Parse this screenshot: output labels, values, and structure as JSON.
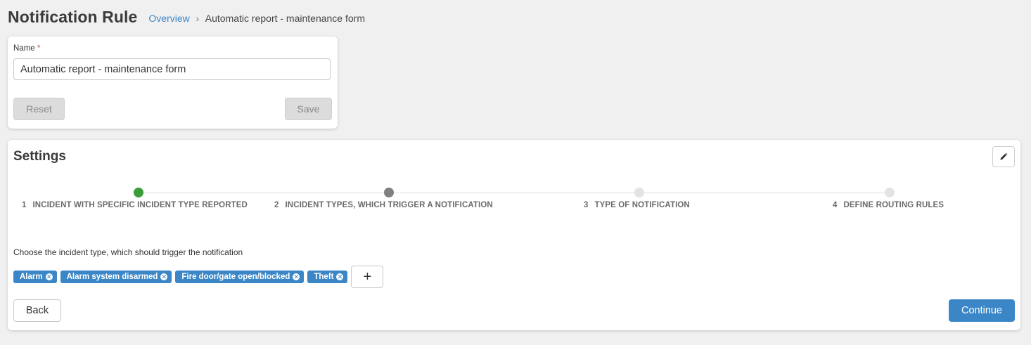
{
  "header": {
    "title": "Notification Rule",
    "breadcrumb": {
      "link": "Overview",
      "separator": "›",
      "current": "Automatic report - maintenance form"
    }
  },
  "name_form": {
    "label": "Name",
    "required_mark": "*",
    "value": "Automatic report - maintenance form",
    "reset_label": "Reset",
    "save_label": "Save"
  },
  "settings": {
    "title": "Settings",
    "edit_icon": "pencil-icon",
    "steps": [
      {
        "num": "1",
        "label": "INCIDENT WITH SPECIFIC INCIDENT TYPE REPORTED",
        "state": "done",
        "color": "#3a9d3a"
      },
      {
        "num": "2",
        "label": "INCIDENT TYPES, WHICH TRIGGER A NOTIFICATION",
        "state": "active",
        "color": "#808080"
      },
      {
        "num": "3",
        "label": "TYPE OF NOTIFICATION",
        "state": "pending",
        "color": "#e3e3e3"
      },
      {
        "num": "4",
        "label": "DEFINE ROUTING RULES",
        "state": "pending",
        "color": "#e3e3e3"
      }
    ],
    "instruction": "Choose the incident type, which should trigger the notification",
    "tags": [
      {
        "label": "Alarm"
      },
      {
        "label": "Alarm system disarmed"
      },
      {
        "label": "Fire door/gate open/blocked"
      },
      {
        "label": "Theft"
      }
    ],
    "add_label": "+",
    "back_label": "Back",
    "continue_label": "Continue"
  },
  "colors": {
    "accent": "#3b86c6",
    "step_done": "#3a9d3a",
    "step_active": "#808080",
    "step_pending": "#e3e3e3"
  }
}
